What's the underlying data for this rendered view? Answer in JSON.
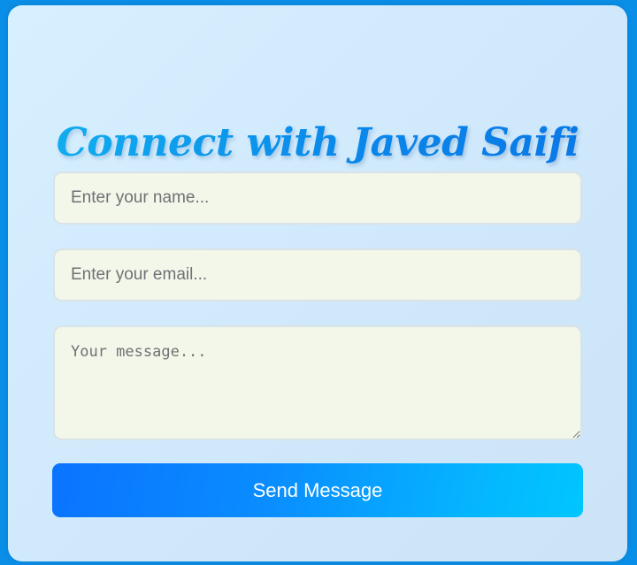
{
  "form": {
    "title": "Connect with Javed Saifi",
    "name_placeholder": "Enter your name...",
    "email_placeholder": "Enter your email...",
    "message_placeholder": "Your message...",
    "send_label": "Send Message"
  },
  "colors": {
    "page_background": "#0a8fe8",
    "title_gradient_start": "#12b2ef",
    "title_gradient_end": "#0a76e6",
    "field_background": "#f2f7ea",
    "button_gradient_start": "#0a74ff",
    "button_gradient_end": "#00c6ff"
  }
}
